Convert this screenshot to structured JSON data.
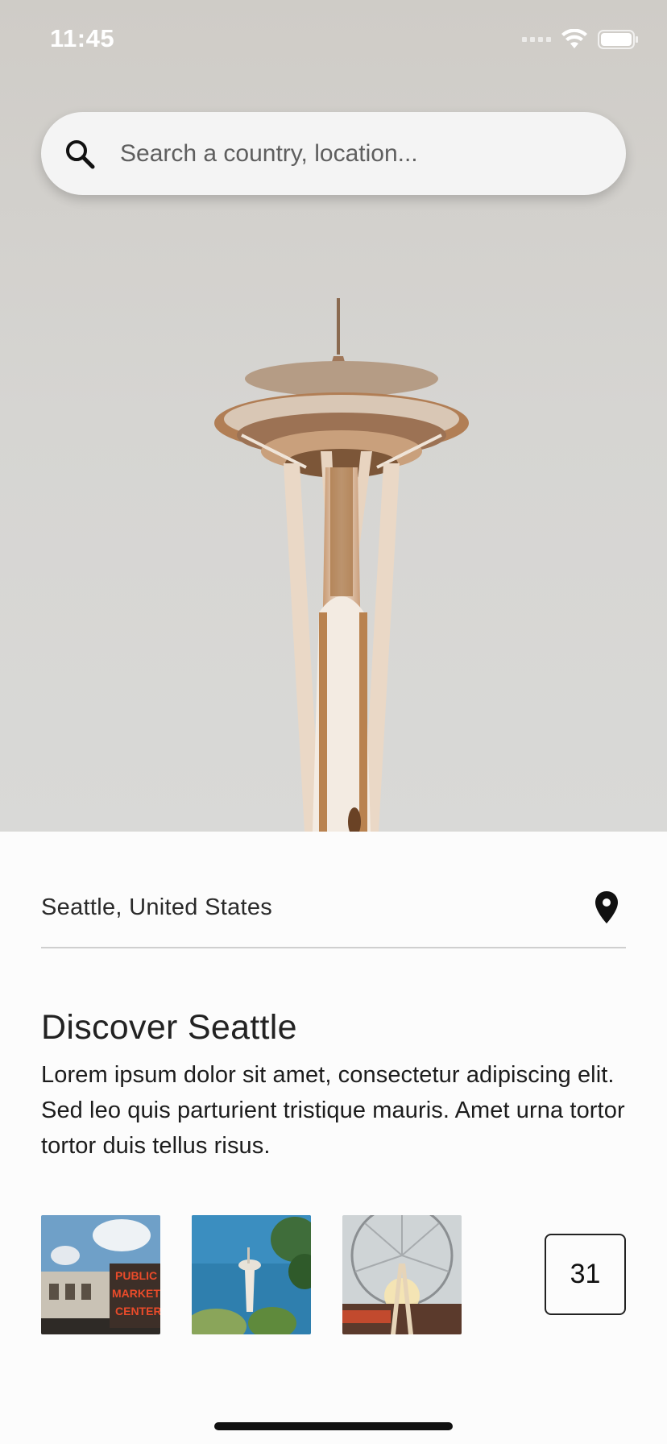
{
  "status_bar": {
    "time": "11:45",
    "icons": [
      "signal-icon",
      "wifi-icon",
      "battery-icon"
    ]
  },
  "search": {
    "placeholder": "Search a country, location...",
    "value": "",
    "icon": "search-icon"
  },
  "location": {
    "label": "Seattle, United States",
    "icon": "location-pin-icon"
  },
  "discover": {
    "title": "Discover Seattle",
    "description": "Lorem ipsum dolor sit amet, consectetur adipiscing elit. Sed leo quis parturient tristique mauris. Amet urna tortor tortor duis tellus risus."
  },
  "gallery": {
    "thumbnails": [
      {
        "label": "PUBLIC MARKET CENTER"
      },
      {
        "label": ""
      },
      {
        "label": ""
      }
    ],
    "more_count": "31"
  },
  "colors": {
    "background": "#fcfcfc",
    "text": "#222222",
    "divider": "#cfcfcf",
    "search_bg": "#f4f4f4"
  }
}
